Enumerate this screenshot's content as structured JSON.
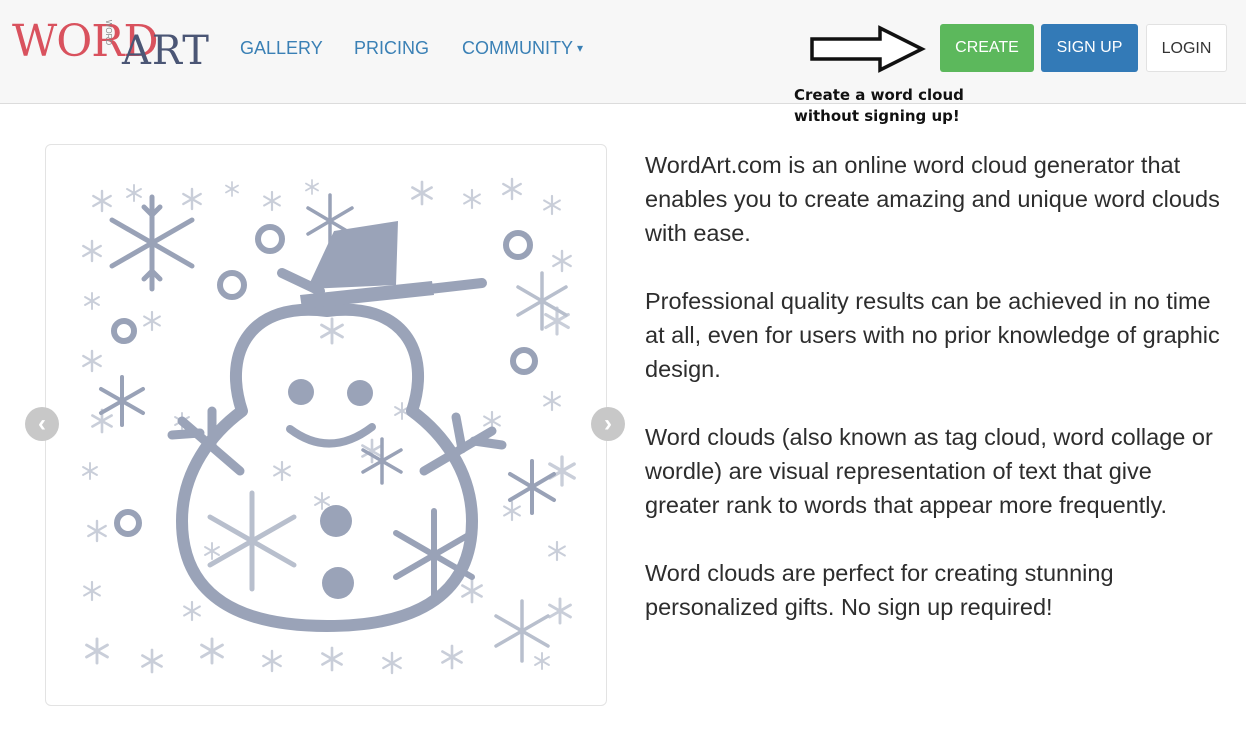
{
  "brand": {
    "logo_word": "WORD",
    "logo_small": "WORD",
    "logo_art": "ART"
  },
  "nav": {
    "links": [
      "GALLERY",
      "PRICING",
      "COMMUNITY"
    ],
    "caret": "▾"
  },
  "actions": {
    "create": "CREATE",
    "signup": "SIGN UP",
    "login": "LOGIN"
  },
  "annotation": {
    "line1": "Create a word cloud",
    "line2": "without signing up!"
  },
  "carousel": {
    "prev_icon": "chevron-left-icon",
    "next_icon": "chevron-right-icon",
    "prev_glyph": "‹",
    "next_glyph": "›",
    "image": "snowman-word-cloud"
  },
  "description": [
    "WordArt.com is an online word cloud generator that enables you to create amazing and unique word clouds with ease.",
    "Professional quality results can be achieved in no time at all, even for users with no prior knowledge of graphic design.",
    "Word clouds (also known as tag cloud, word collage or wordle) are visual representation of text that give greater rank to words that appear more frequently.",
    "Word clouds are perfect for creating stunning personalized gifts. No sign up required!"
  ],
  "colors": {
    "create": "#5cb85c",
    "signup": "#337ab7",
    "link": "#3a80b5",
    "logo_red": "#d9525e",
    "logo_navy": "#4b5675",
    "snowman": "#9aa3b8"
  }
}
